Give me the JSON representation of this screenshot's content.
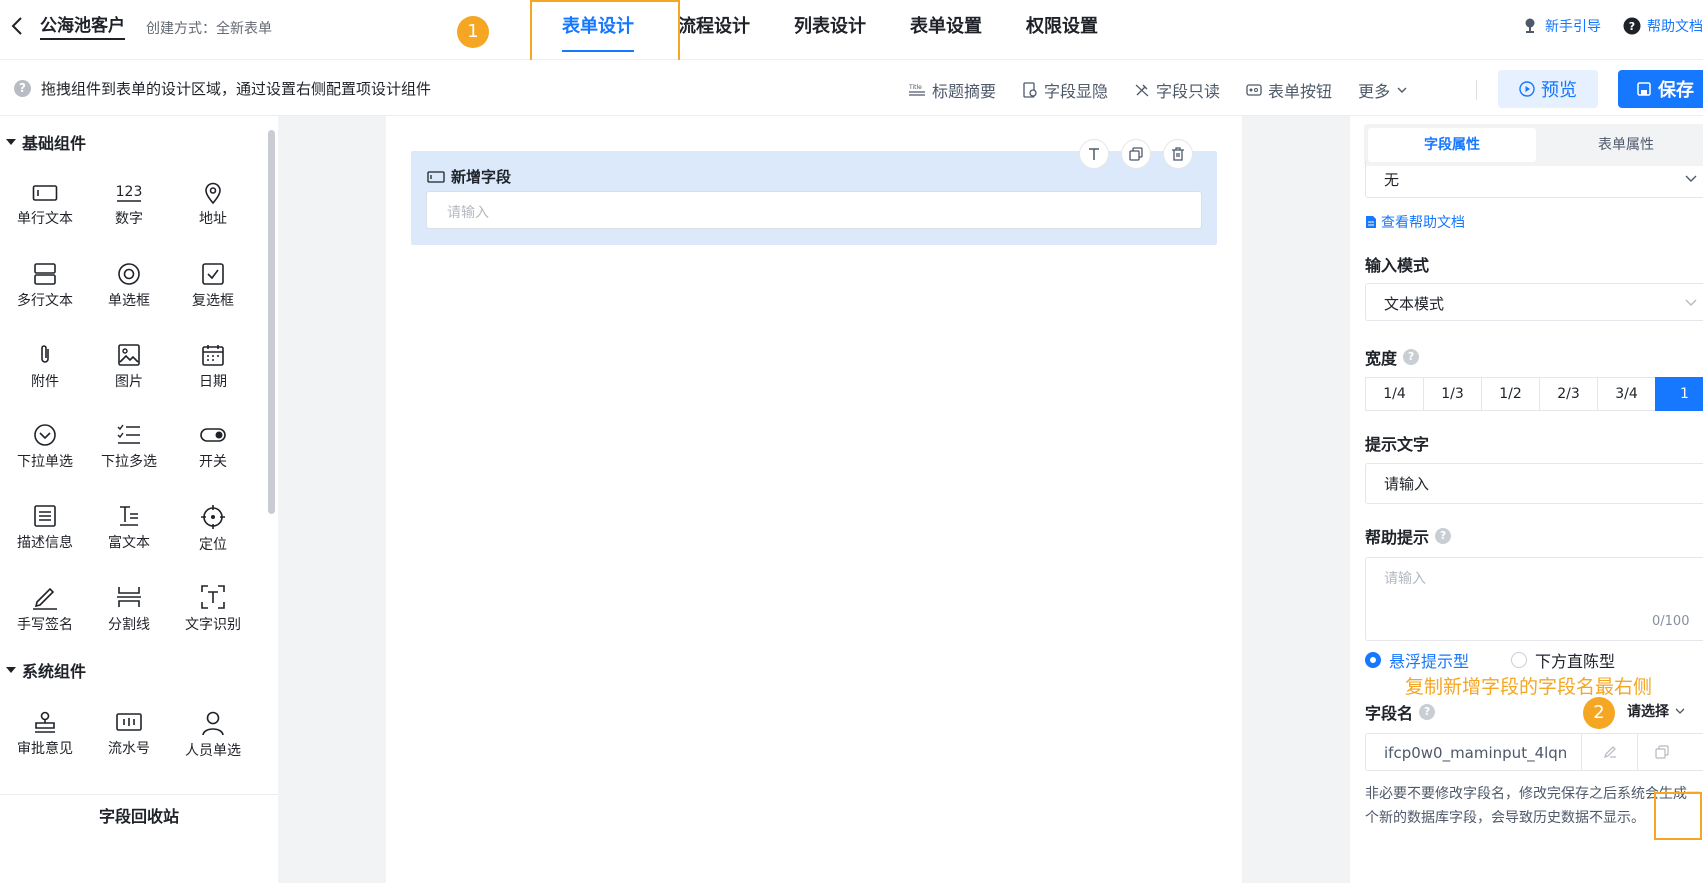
{
  "header": {
    "app_title": "公海池客户",
    "create_mode": "创建方式：全新表单",
    "badge_1": "1",
    "tabs": [
      {
        "label": "表单设计",
        "active": true
      },
      {
        "label": "流程设计"
      },
      {
        "label": "列表设计"
      },
      {
        "label": "表单设置"
      },
      {
        "label": "权限设置"
      }
    ],
    "guide_link": "新手引导",
    "help_link": "帮助文档"
  },
  "toolbar": {
    "hint": "拖拽组件到表单的设计区域，通过设置右侧配置项设计组件",
    "tools": [
      "标题摘要",
      "字段显隐",
      "字段只读",
      "表单按钮",
      "更多"
    ],
    "title_icon_text": "Title",
    "preview_label": "预览",
    "save_label": "保存"
  },
  "left": {
    "group_basic": "基础组件",
    "basic_items": [
      "单行文本",
      "数字",
      "地址",
      "多行文本",
      "单选框",
      "复选框",
      "附件",
      "图片",
      "日期",
      "下拉单选",
      "下拉多选",
      "开关",
      "描述信息",
      "富文本",
      "定位",
      "手写签名",
      "分割线",
      "文字识别"
    ],
    "number_icon_text": "123",
    "group_system": "系统组件",
    "system_items": [
      "审批意见",
      "流水号",
      "人员单选"
    ],
    "recycle": "字段回收站"
  },
  "canvas": {
    "field_title": "新增字段",
    "field_placeholder": "请输入"
  },
  "right": {
    "tab_field": "字段属性",
    "tab_form": "表单属性",
    "top_select_value": "无",
    "doc_link": "查看帮助文档",
    "input_mode_label": "输入模式",
    "input_mode_value": "文本模式",
    "width_label": "宽度",
    "width_options": [
      "1/4",
      "1/3",
      "1/2",
      "2/3",
      "3/4",
      "1"
    ],
    "width_active": "1",
    "placeholder_label": "提示文字",
    "placeholder_value": "请输入",
    "help_label": "帮助提示",
    "help_placeholder": "请输入",
    "help_counter": "0/100",
    "radio_hover": "悬浮提示型",
    "radio_below": "下方直陈型",
    "annotation_note": "复制新增字段的字段名最右侧",
    "badge_2": "2",
    "field_name_label": "字段名",
    "select_small": "请选择",
    "field_name_value": "ifcp0w0_maminput_4lqn",
    "warning": "非必要不要修改字段名，修改完保存之后系统会生成一个新的数据库字段，会导致历史数据不显示。"
  },
  "colors": {
    "primary": "#1677ff",
    "annotation": "#f5a623",
    "field_bg": "#dbe9fb"
  }
}
